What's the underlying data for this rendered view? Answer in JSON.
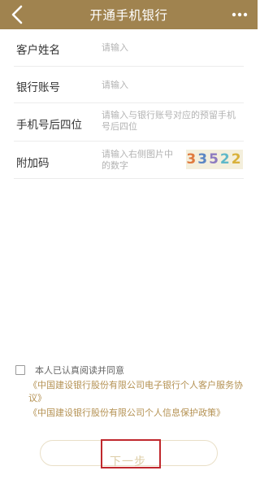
{
  "header": {
    "title": "开通手机银行",
    "back_icon": "chevron-left-icon",
    "more_icon": "more-dots-icon",
    "background_color": "#a0834f"
  },
  "form": {
    "fields": [
      {
        "label": "客户姓名",
        "placeholder": "请输入"
      },
      {
        "label": "银行账号",
        "placeholder": "请输入"
      },
      {
        "label": "手机号后四位",
        "placeholder": "请输入与银行账号对应的预留手机号后四位"
      },
      {
        "label": "附加码",
        "placeholder": "请输入右侧图片中的数字"
      }
    ],
    "captcha": {
      "digits": [
        {
          "char": "3",
          "color": "#e07a3e"
        },
        {
          "char": "3",
          "color": "#5b86c4"
        },
        {
          "char": "5",
          "color": "#8d7bc0"
        },
        {
          "char": "2",
          "color": "#5fb8c9"
        },
        {
          "char": "2",
          "color": "#d9b13a"
        }
      ]
    }
  },
  "agreement": {
    "checkbox_label": "本人已认真阅读并同意",
    "checked": false,
    "links": [
      "《中国建设银行股份有限公司电子银行个人客户服务协议》",
      "《中国建设银行股份有限公司个人信息保护政策》"
    ],
    "link_color": "#b49152"
  },
  "next_button": {
    "label": "下一步",
    "enabled": false
  },
  "annotation": {
    "highlight_color": "#c0282d"
  }
}
